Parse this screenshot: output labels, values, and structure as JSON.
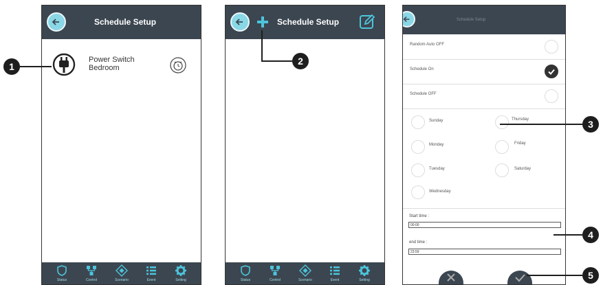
{
  "phone1": {
    "title": "Schedule Setup",
    "device": {
      "name_line1": "Power Switch",
      "name_line2": "Bedroom",
      "icon": "plug-icon",
      "action_icon": "alarm-clock-icon"
    },
    "nav": [
      {
        "label": "Status",
        "icon": "shield-icon"
      },
      {
        "label": "Control",
        "icon": "network-icon"
      },
      {
        "label": "Scenario",
        "icon": "diamond-icon"
      },
      {
        "label": "Event",
        "icon": "list-icon"
      },
      {
        "label": "Setting",
        "icon": "gear-icon"
      }
    ]
  },
  "phone2": {
    "title": "Schedule Setup",
    "add_icon": "plus-icon",
    "edit_icon": "edit-icon",
    "nav": [
      {
        "label": "Status",
        "icon": "shield-icon"
      },
      {
        "label": "Control",
        "icon": "network-icon"
      },
      {
        "label": "Scenario",
        "icon": "diamond-icon"
      },
      {
        "label": "Event",
        "icon": "list-icon"
      },
      {
        "label": "Setting",
        "icon": "gear-icon"
      }
    ]
  },
  "phone3": {
    "title": "Schedule Setup",
    "options": [
      {
        "label": "Random Auto OFF",
        "checked": false
      },
      {
        "label": "Schedule On",
        "checked": true
      },
      {
        "label": "Schedule OFF",
        "checked": false
      }
    ],
    "days": [
      "Sunday",
      "Thursday",
      "Monday",
      "Friday",
      "Tuesday",
      "Saturday",
      "Wednesday"
    ],
    "start_label": "Start time :",
    "start_value": "00:00",
    "end_label": "end time :",
    "end_value": "23:59",
    "cancel_icon": "close-icon",
    "confirm_icon": "check-icon"
  },
  "callouts": [
    "1",
    "2",
    "3",
    "4",
    "5"
  ],
  "colors": {
    "bar": "#3c4650",
    "accent": "#4cc5dc",
    "callout": "#1e1e1e"
  }
}
